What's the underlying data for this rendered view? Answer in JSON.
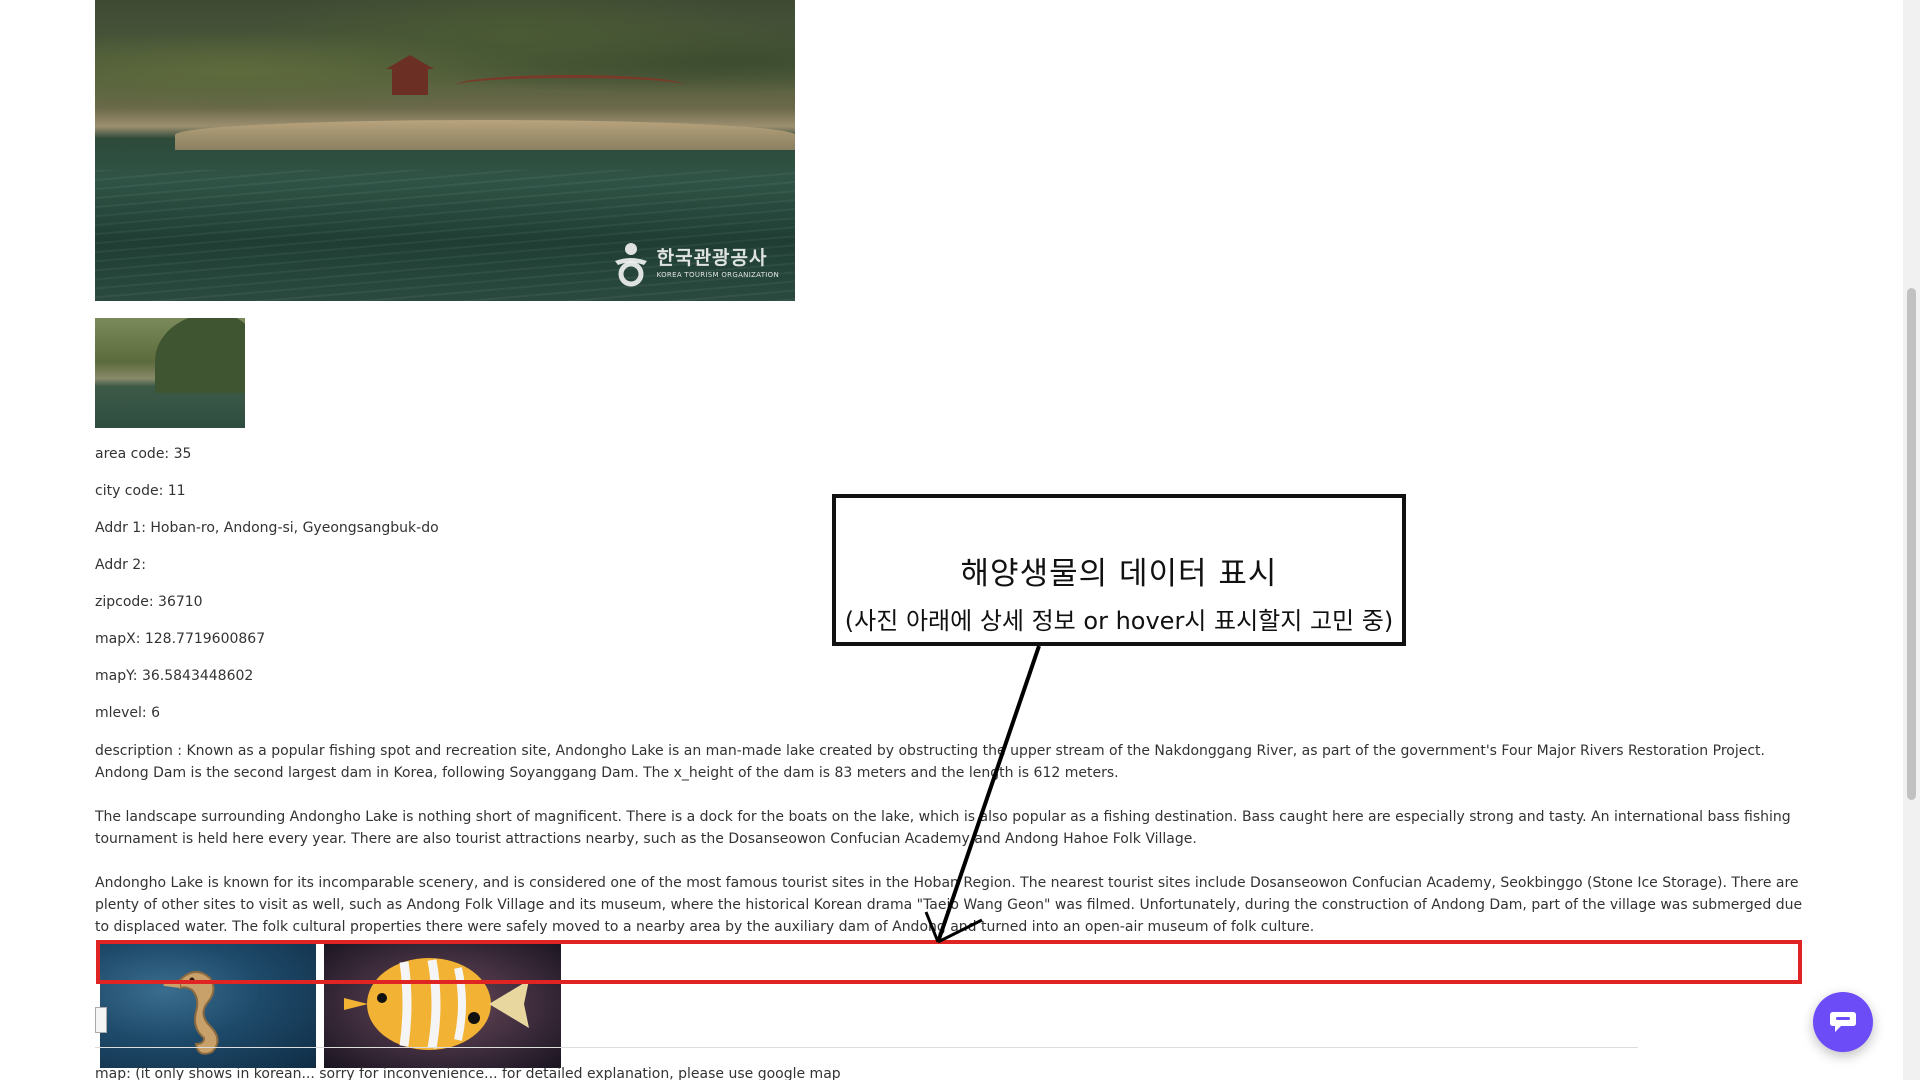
{
  "main_image": {
    "watermark_ko": "한국관광공사",
    "watermark_en": "KOREA TOURISM ORGANIZATION"
  },
  "info": {
    "area_code": "area code: 35",
    "city_code": "city code: 11",
    "addr1": "Addr 1: Hoban-ro, Andong-si, Gyeongsangbuk-do",
    "addr2": "Addr 2:",
    "zipcode": "zipcode: 36710",
    "mapx": "mapX: 128.7719600867",
    "mapy": "mapY: 36.5843448602",
    "mlevel": "mlevel: 6"
  },
  "description": {
    "p1": "description : Known as a popular fishing spot and recreation site, Andongho Lake is an man-made lake created by obstructing the upper stream of the Nakdonggang River, as part of the government's Four Major Rivers Restoration Project. Andong Dam is the second largest dam in Korea, following Soyanggang Dam. The x_height of the dam is 83 meters and the length is 612 meters.",
    "p2": "The landscape surrounding Andongho Lake is nothing short of magnificent. There is a dock for the boats on the lake, which is also popular as a fishing destination. Bass caught here are especially strong and tasty. An international bass fishing tournament is held here every year. There are also tourist attractions nearby, such as the Dosanseowon Confucian Academy and Andong Hahoe Folk Village.",
    "p3": "Andongho Lake is known for its incomparable scenery, and is considered one of the most famous tourist sites in the Hoban Region. The nearest tourist sites include Dosanseowon Confucian Academy, Seokbinggo (Stone Ice Storage). There are plenty of other sites to visit as well, such as Andong Folk Village and its museum, where the historical Korean drama \"Taejo Wang Geon\" was filmed. Unfortunately, during the construction of Andong Dam, part of the village was submerged due to displaced water. The folk cultural properties there were safely moved to a nearby area by the auxiliary dam of Andong and turned into an open-air museum of folk culture."
  },
  "callout": {
    "title": "해양생물의 데이터 표시",
    "subtitle": "(사진 아래에 상세 정보 or hover시 표시할지 고민 중)"
  },
  "map_text": "map: (it only shows in korean... sorry for inconvenience... for detailed explanation, please use google map",
  "colors": {
    "annotation_red": "#e02424",
    "chat_button": "#6b4cf6"
  },
  "icons": {
    "chat": "chat-bubble-icon"
  }
}
